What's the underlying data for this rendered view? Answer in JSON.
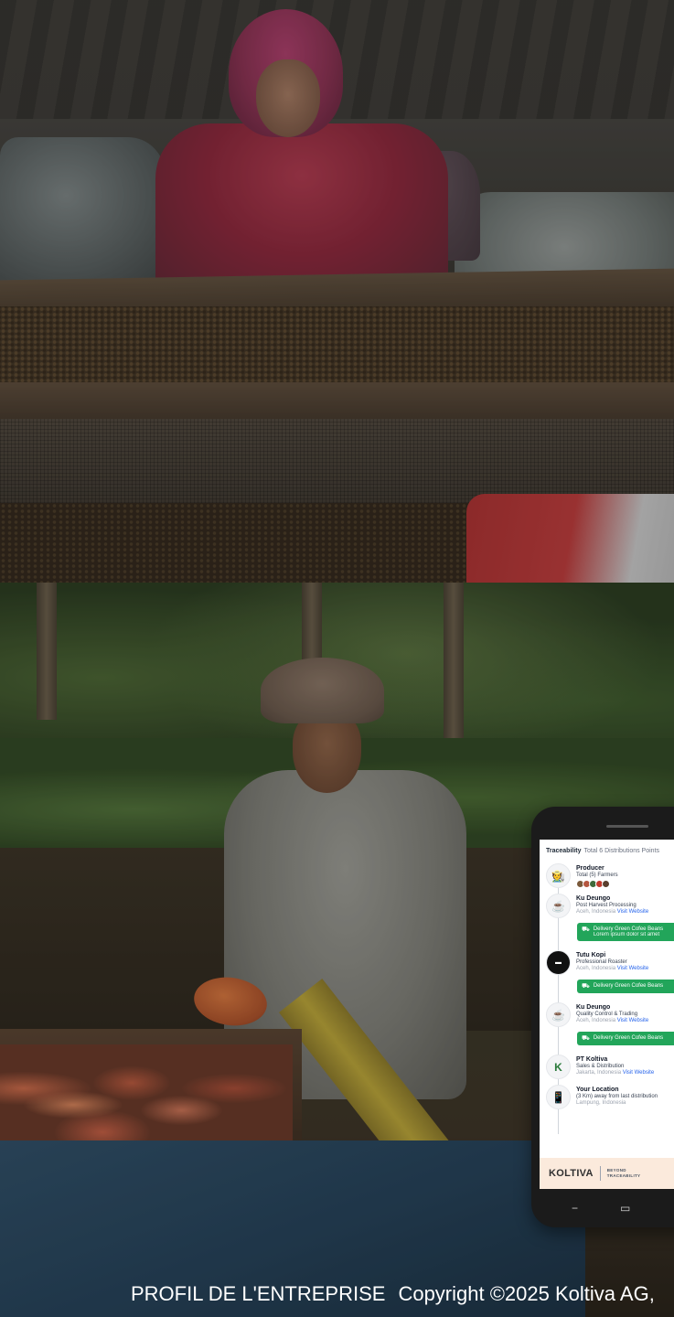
{
  "phone_app": {
    "header": {
      "title": "Traceability",
      "subtitle": "Total 6 Distributions Points"
    },
    "timeline": [
      {
        "icon": "producer-icon",
        "glyph": "🧑‍🌾",
        "name": "Producer",
        "role": "Total (5) Farmers",
        "location": "",
        "link": ""
      },
      {
        "icon": "ku-deungu-logo-icon",
        "glyph": "☕",
        "name": "Ku Deungo",
        "role": "Post Harvest Processing",
        "location": "Aceh, Indonesia",
        "link": "Visit Website"
      },
      {
        "icon": "tutu-kopi-logo-icon",
        "glyph": "▬",
        "name": "Tutu Kopi",
        "role": "Professional Roaster",
        "location": "Aceh, Indonesia",
        "link": "Visit Website"
      },
      {
        "icon": "ku-deungu-logo-icon",
        "glyph": "☕",
        "name": "Ku Deungo",
        "role": "Quality Control & Trading",
        "location": "Aceh, Indonesia",
        "link": "Visit Website"
      },
      {
        "icon": "koltiva-k-logo-icon",
        "glyph": "K",
        "name": "PT Koltiva",
        "role": "Sales & Distribution",
        "location": "Jakarta, Indonesia",
        "link": "Visit Website"
      },
      {
        "icon": "phone-location-icon",
        "glyph": "📱",
        "name": "Your Location",
        "role": "(3 Km) away from last distribution",
        "location": "Lampung, Indonesia",
        "link": ""
      }
    ],
    "deliveries": [
      {
        "label": "Delivery Green Cofee Beans",
        "detail": "Lorem ipsum dolor sit amet"
      },
      {
        "label": "Delivery Green Cofee Beans",
        "detail": ""
      },
      {
        "label": "Delivery Green Cofee Beans",
        "detail": ""
      }
    ],
    "footer": {
      "brand": "KOLTIVA",
      "tagline_line1": "BEYOND",
      "tagline_line2": "TRACEABILITY"
    }
  },
  "footer": {
    "company_profile": "PROFIL DE L'ENTREPRISE",
    "copyright": "Copyright ©2025 Koltiva AG,"
  },
  "colors": {
    "delivery_green": "#22a55a",
    "link_blue": "#2563eb",
    "brand_accent": "#d4552e",
    "phone_footer_bg": "#fbeadc"
  }
}
